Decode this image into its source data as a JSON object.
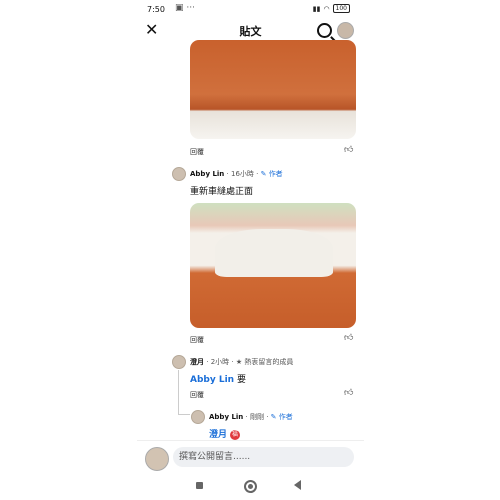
{
  "status_bar": {
    "time": "7:50",
    "overflow": "▣ ···",
    "battery": "100"
  },
  "header": {
    "title": "貼文"
  },
  "comments": [
    {
      "reply_label": "回覆"
    },
    {
      "author": "Abby Lin",
      "time": "16小時",
      "role": "作者",
      "text": "重新車縫處正面",
      "reply_label": "回覆"
    },
    {
      "author": "澄月",
      "time": "2小時",
      "role": "熱衷留言的成員",
      "mention": "Abby Lin",
      "text": "要",
      "reply_label": "回覆"
    },
    {
      "author": "Abby Lin",
      "time": "剛剛",
      "role": "作者",
      "mention": "澄月",
      "badge": "福"
    }
  ],
  "composer": {
    "placeholder": "撰寫公開留言......"
  },
  "colors": {
    "link": "#1a6ed8",
    "badge": "#e0393e"
  }
}
